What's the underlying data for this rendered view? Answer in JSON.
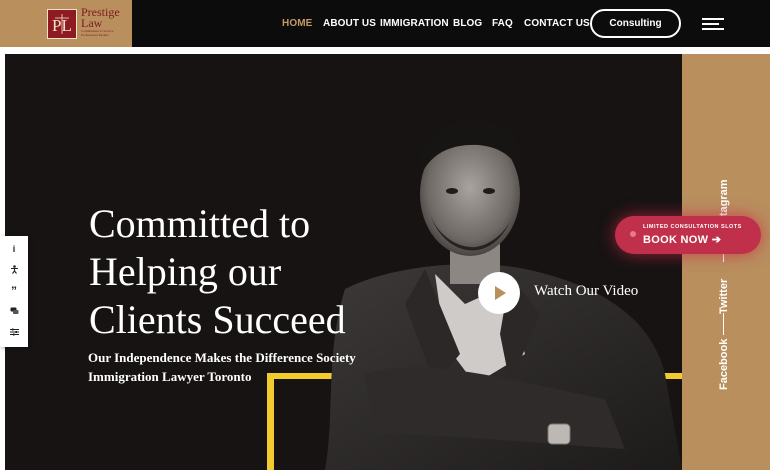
{
  "brand": {
    "monogram": "PL",
    "name_line1": "Prestige",
    "name_line2": "Law",
    "tagline_line1": "Commitment to Service",
    "tagline_line2": "Professional Results"
  },
  "nav": {
    "items": [
      {
        "label": "HOME",
        "active": true
      },
      {
        "label": "ABOUT US",
        "active": false
      },
      {
        "label": "IMMIGRATION",
        "active": false
      },
      {
        "label": "BLOG",
        "active": false
      },
      {
        "label": "FAQ",
        "active": false
      },
      {
        "label": "CONTACT US",
        "active": false
      }
    ],
    "cta_label": "Consulting",
    "menu_icon": "hamburger-menu-icon"
  },
  "hero": {
    "title_lines": [
      "Committed to",
      "Helping our",
      "Clients Succeed"
    ],
    "subtitle_line1": "Our Independence Makes the Difference Society",
    "subtitle_line2": "Immigration Lawyer Toronto",
    "video_label": "Watch Our Video",
    "play_icon": "play-icon"
  },
  "social": {
    "facebook": "Facebook",
    "twitter": "Twitter",
    "instagram": "Instagram"
  },
  "booking": {
    "small_text": "LIMITED CONSULTATION SLOTS",
    "button_label": "BOOK NOW ➔"
  },
  "side_tools": [
    {
      "icon": "info-icon",
      "glyph": "i"
    },
    {
      "icon": "accessibility-icon",
      "glyph": ""
    },
    {
      "icon": "quote-icon",
      "glyph": "”"
    },
    {
      "icon": "chat-icon",
      "glyph": ""
    },
    {
      "icon": "settings-sliders-icon",
      "glyph": ""
    }
  ],
  "colors": {
    "header_bg": "#0d0c0c",
    "gold": "#b98f5e",
    "nav_active": "#c39a66",
    "hero_bg": "#171313",
    "accent_yellow": "#f2cc2e",
    "book_red": "#c0304a",
    "logo_red": "#8f1b22"
  }
}
